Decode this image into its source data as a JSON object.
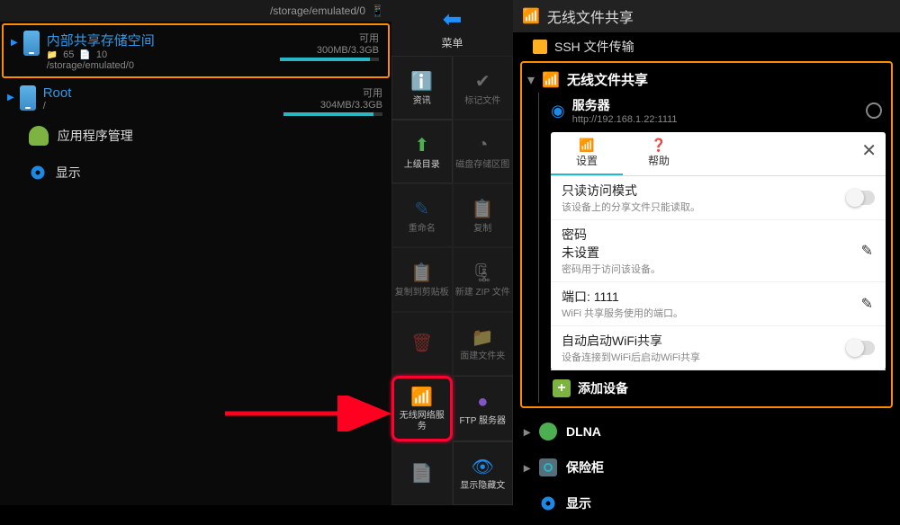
{
  "panel1": {
    "header_path": "/storage/emulated/0",
    "storage1": {
      "title": "内部共享存储空间",
      "folders": "65",
      "files": "10",
      "path": "/storage/emulated/0",
      "avail_label": "可用",
      "size": "300MB/3.3GB"
    },
    "storage2": {
      "title": "Root",
      "path": "/",
      "avail_label": "可用",
      "size": "304MB/3.3GB"
    },
    "apps": "应用程序管理",
    "display": "显示"
  },
  "panel2": {
    "menu_label": "菜单",
    "items": {
      "info": "资讯",
      "mark": "标记文件",
      "up": "上级目录",
      "disk": "磁盘存储区图",
      "rename": "重命名",
      "copy": "复制",
      "clipboard": "复制到剪贴板",
      "newzip": "新建 ZIP 文件",
      "delete": "",
      "newfolder": "面建文件夹",
      "wifi": "无线网络服务",
      "ftp": "FTP 服务器",
      "hidden": "显示隐藏文"
    }
  },
  "panel3": {
    "header": "无线文件共享",
    "ssh": "SSH 文件传输",
    "wifi_share": "无线文件共享",
    "server": "服务器",
    "server_url": "http://192.168.1.22:1111",
    "tabs": {
      "settings": "设置",
      "help": "帮助"
    },
    "readonly": {
      "title": "只读访问模式",
      "sub": "该设备上的分享文件只能读取。"
    },
    "password": {
      "title": "密码",
      "value": "未设置",
      "sub": "密码用于访问该设备。"
    },
    "port": {
      "title": "端口",
      "value": "1111",
      "sub": "WiFi 共享服务使用的端口。"
    },
    "autostart": {
      "title": "自动启动WiFi共享",
      "sub": "设备连接到WiFi后启动WiFi共享"
    },
    "add_device": "添加设备",
    "dlna": "DLNA",
    "safe": "保险柜",
    "display": "显示"
  }
}
